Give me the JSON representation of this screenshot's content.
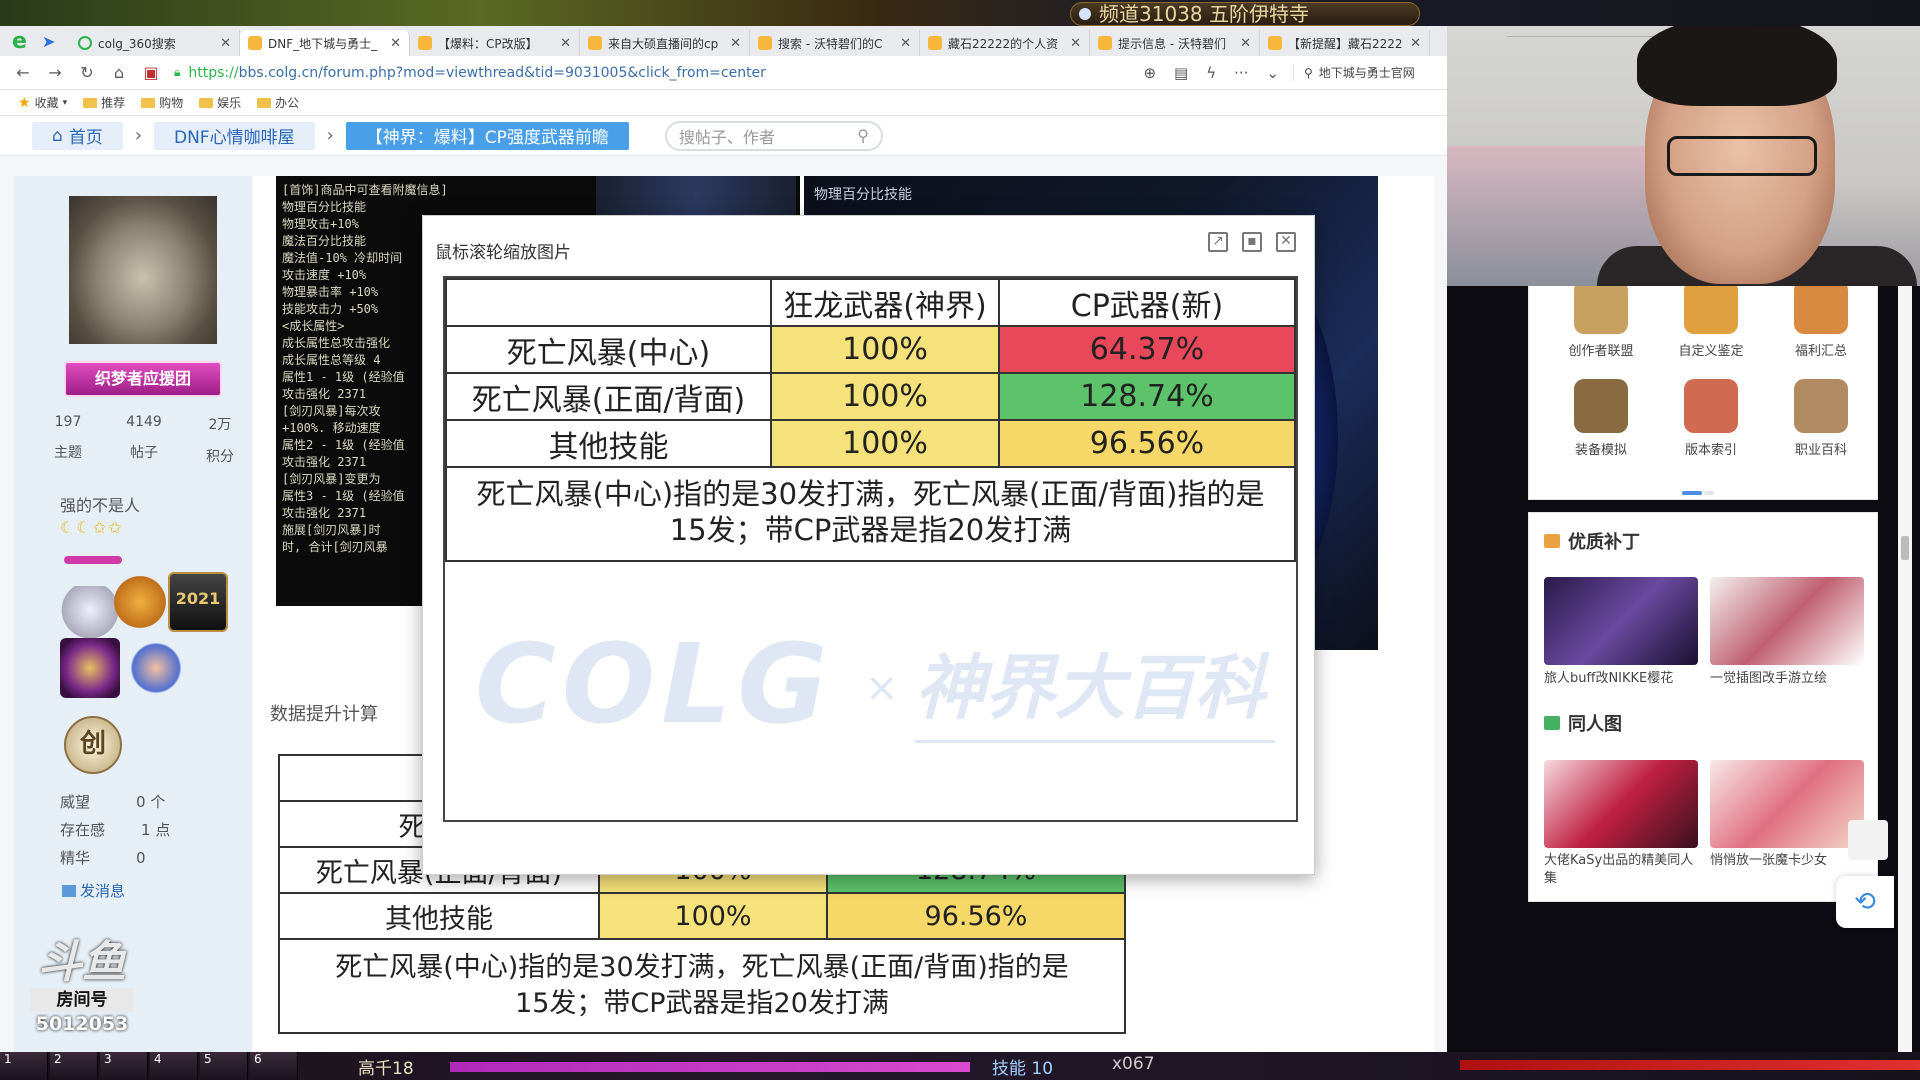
{
  "game": {
    "channel": "频道31038 五阶伊特寺",
    "bottom": {
      "slot_keys": [
        "1",
        "2",
        "3",
        "4",
        "5",
        "6"
      ],
      "high_stat": "高千18",
      "skill_label": "技能",
      "skill_value": "10",
      "count": "x067"
    }
  },
  "browser": {
    "tabs": [
      {
        "title": "colg_360搜索",
        "active": false
      },
      {
        "title": "DNF_地下城与勇士_",
        "active": true
      },
      {
        "title": "【爆料：CP改版】",
        "active": false
      },
      {
        "title": "来自大硕直播间的cp",
        "active": false
      },
      {
        "title": "搜索 - 沃特碧们的C",
        "active": false
      },
      {
        "title": "藏石22222的个人资",
        "active": false
      },
      {
        "title": "提示信息 - 沃特碧们",
        "active": false
      },
      {
        "title": "【新提醒】藏石2222",
        "active": false
      }
    ],
    "url_scheme": "https://",
    "url_rest": "bbs.colg.cn/forum.php?mod=viewthread&tid=9031005&click_from=center",
    "address_search": "地下城与勇士官网",
    "bookmarks": [
      "收藏",
      "推荐",
      "购物",
      "娱乐",
      "办公"
    ]
  },
  "forum": {
    "breadcrumb": [
      "首页",
      "DNF心情咖啡屋",
      "【神界：爆料】CP强度武器前瞻"
    ],
    "search_placeholder": "搜帖子、作者",
    "user": {
      "badge": "织梦者应援团",
      "stats": [
        {
          "value": "197",
          "label": "主题"
        },
        {
          "value": "4149",
          "label": "帖子"
        },
        {
          "value": "2万",
          "label": "积分"
        }
      ],
      "title": "强的不是人",
      "moons": "☾☾✩✩",
      "medal_2021": "2021",
      "chuang": "创",
      "info": [
        {
          "label": "威望",
          "value": "0 个"
        },
        {
          "label": "存在感",
          "value": "1 点"
        },
        {
          "label": "精华",
          "value": "0"
        }
      ],
      "pm": "发消息"
    },
    "post_img1_lines": [
      "[首饰]商品中可查看附魔信息]",
      "物理百分比技能",
      "物理攻击+10%",
      "魔法百分比技能",
      "魔法值-10% 冷却时间",
      "攻击速度 +10%",
      "物理暴击率 +10%",
      "技能攻击力 +50%",
      "<成长属性>",
      "成长属性总攻击强化",
      "成长属性总等级 4",
      "属性1 - 1级 (经验值",
      "  攻击强化 2371",
      "  [剑刃风暴]每次攻",
      "  +100%. 移动速度",
      "属性2 - 1级 (经验值",
      "  攻击强化 2371",
      "  [剑刃风暴]变更为",
      "属性3 - 1级 (经验值",
      "  攻击强化 2371",
      "  施展[剑刃风暴]时",
      "  时, 合计[剑刃风暴"
    ],
    "post_img2_text": "物理百分比技能",
    "section_title": "数据提升计算",
    "sidebar": {
      "icons": [
        {
          "label": "创作者联盟",
          "color": "#c8a060"
        },
        {
          "label": "自定义鉴定",
          "color": "#e0a040"
        },
        {
          "label": "福利汇总",
          "color": "#d88a40"
        },
        {
          "label": "装备模拟",
          "color": "#8a6a40"
        },
        {
          "label": "版本索引",
          "color": "#d06a50"
        },
        {
          "label": "职业百科",
          "color": "#b08a60"
        }
      ],
      "patch_title": "优质补丁",
      "patch_items": [
        {
          "caption": "旅人buff改NIKKE樱花"
        },
        {
          "caption": "一觉插图改手游立绘"
        }
      ],
      "fan_title": "同人图",
      "fan_items": [
        {
          "caption": "大佬KaSy出品的精美同人集"
        },
        {
          "caption": "悄悄放一张魔卡少女"
        }
      ]
    }
  },
  "modal": {
    "title": "鼠标滚轮缩放图片",
    "table": {
      "headers": [
        "",
        "狂龙武器(神界)",
        "CP武器(新)"
      ],
      "rows": [
        {
          "skill": "死亡风暴(中心)",
          "base": "100%",
          "cp": "64.37%",
          "cp_color": "#e8485a"
        },
        {
          "skill": "死亡风暴(正面/背面)",
          "base": "100%",
          "cp": "128.74%",
          "cp_color": "#5cc36a"
        },
        {
          "skill": "其他技能",
          "base": "100%",
          "cp": "96.56%",
          "cp_color": "#f6d868"
        }
      ],
      "note_line1": "死亡风暴(中心)指的是30发打满，死亡风暴(正面/背面)指的是",
      "note_line2": "15发；带CP武器是指20发打满"
    },
    "watermark": {
      "colg": "COLG",
      "x": "×",
      "cn": "神界大百科"
    }
  },
  "bg_table": {
    "rows": [
      {
        "skill": "死亡风",
        "base": "",
        "cp": ""
      },
      {
        "skill": "死亡风暴(正面/背面)",
        "base": "100%",
        "cp": "128.74%"
      },
      {
        "skill": "其他技能",
        "base": "100%",
        "cp": "96.56%"
      }
    ],
    "note_line1": "死亡风暴(中心)指的是30发打满，死亡风暴(正面/背面)指的是",
    "note_line2": "15发；带CP武器是指20发打满"
  },
  "douyu": {
    "brand": "斗鱼",
    "room_label": "房间号",
    "room_no": "5012053"
  }
}
